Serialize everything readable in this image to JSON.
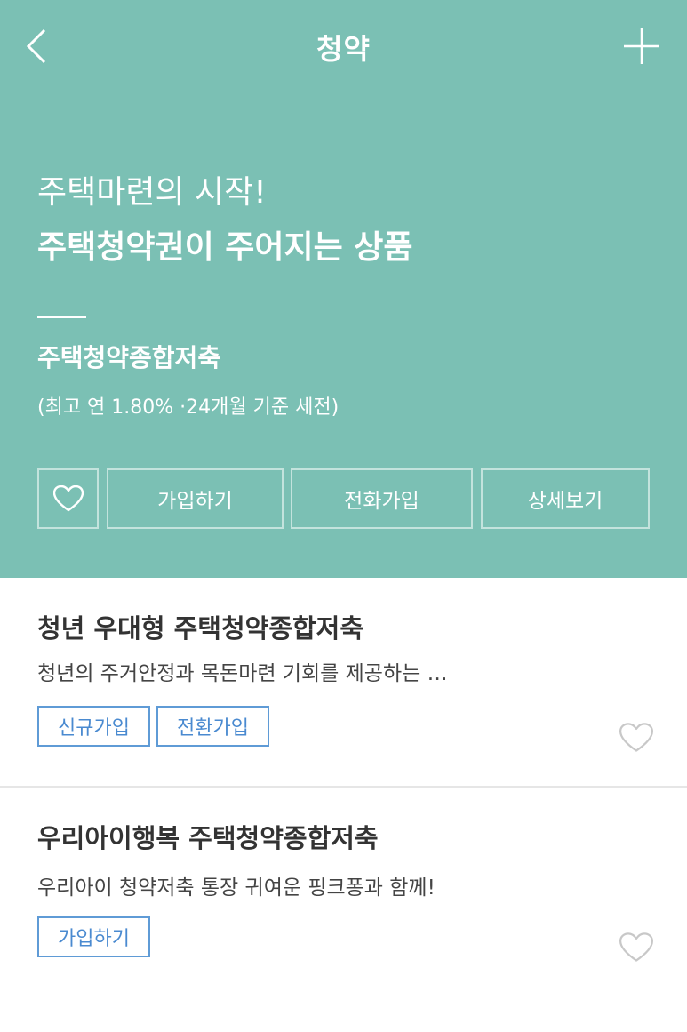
{
  "header": {
    "title": "청약",
    "back_icon": "chevron-left-icon",
    "add_icon": "plus-icon"
  },
  "hero": {
    "headline_line1": "주택마련의 시작!",
    "headline_line2": "주택청약권이 주어지는 상품",
    "product_name": "주택청약종합저축",
    "product_rate": "(최고 연 1.80% ·24개월 기준 세전)",
    "buttons": {
      "favorite_icon": "heart-outline-icon",
      "join_label": "가입하기",
      "phone_join_label": "전화가입",
      "detail_label": "상세보기"
    }
  },
  "products": [
    {
      "title": "청년 우대형 주택청약종합저축",
      "description": "청년의 주거안정과 목돈마련 기회를 제공하는 …",
      "tags": [
        "신규가입",
        "전환가입"
      ],
      "favorite_icon": "heart-outline-icon"
    },
    {
      "title": "우리아이행복 주택청약종합저축",
      "description": "우리아이 청약저축 통장 귀여운 핑크퐁과 함께!",
      "tags": [
        "가입하기"
      ],
      "favorite_icon": "heart-outline-icon"
    }
  ],
  "colors": {
    "hero_background": "#7bc0b4",
    "tag_border": "#5f9bd6",
    "tag_text": "#4a8ad0",
    "heart_gray": "#c8c8c8"
  }
}
